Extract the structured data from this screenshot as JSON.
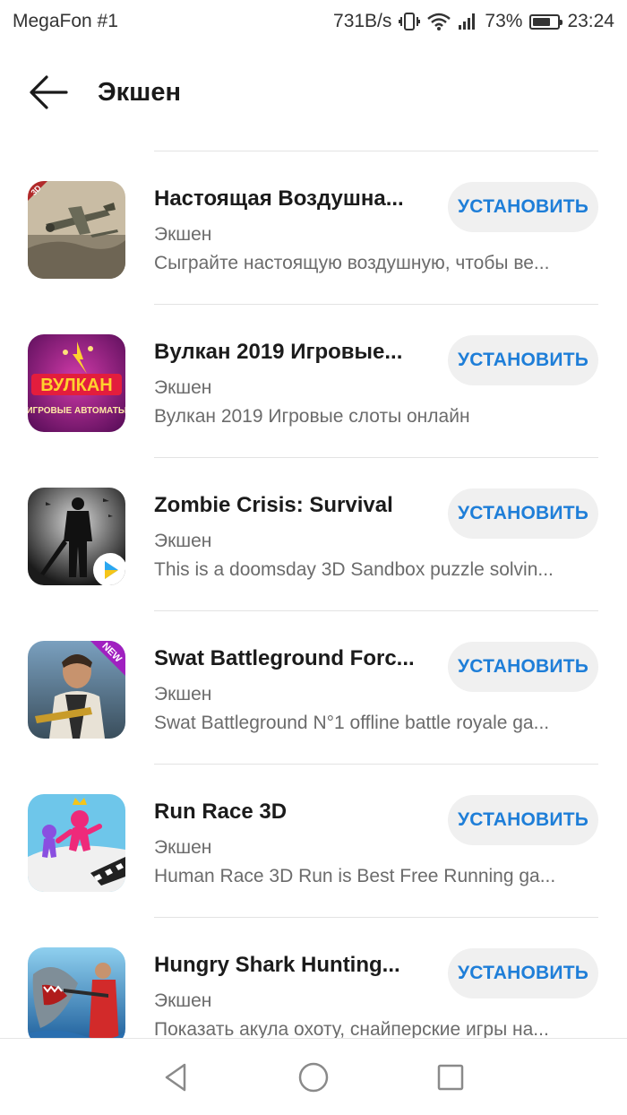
{
  "status_bar": {
    "carrier": "MegaFon #1",
    "speed": "731B/s",
    "battery_percent": "73%",
    "battery_level": 0.73,
    "time": "23:24"
  },
  "header": {
    "title": "Экшен"
  },
  "apps": [
    {
      "name": "Настоящая Воздушна...",
      "category": "Экшен",
      "description": "Сыграйте настоящую воздушную, чтобы ве...",
      "button": "УСТАНОВИТЬ",
      "badge": "3D"
    },
    {
      "name": "Вулкан 2019 Игровые...",
      "category": "Экшен",
      "description": "Вулкан 2019 Игровые слоты онлайн",
      "button": "УСТАНОВИТЬ",
      "logo_text": "ВУЛКАН",
      "logo_subtext": "ИГРОВЫЕ АВТОМАТЫ"
    },
    {
      "name": "Zombie Crisis: Survival",
      "category": "Экшен",
      "description": "This is a doomsday 3D Sandbox puzzle solvin...",
      "button": "УСТАНОВИТЬ"
    },
    {
      "name": "Swat Battleground Forc...",
      "category": "Экшен",
      "description": "Swat Battleground N°1 offline battle royale ga...",
      "button": "УСТАНОВИТЬ",
      "badge": "NEW"
    },
    {
      "name": "Run Race 3D",
      "category": "Экшен",
      "description": "Human Race 3D Run is Best Free Running ga...",
      "button": "УСТАНОВИТЬ"
    },
    {
      "name": "Hungry Shark Hunting...",
      "category": "Экшен",
      "description": "Показать акула охоту, снайперские игры на...",
      "button": "УСТАНОВИТЬ"
    }
  ],
  "colors": {
    "accent": "#1e7ed8",
    "button_bg": "#f0f0f0",
    "secondary_text": "#6b6b6b"
  }
}
